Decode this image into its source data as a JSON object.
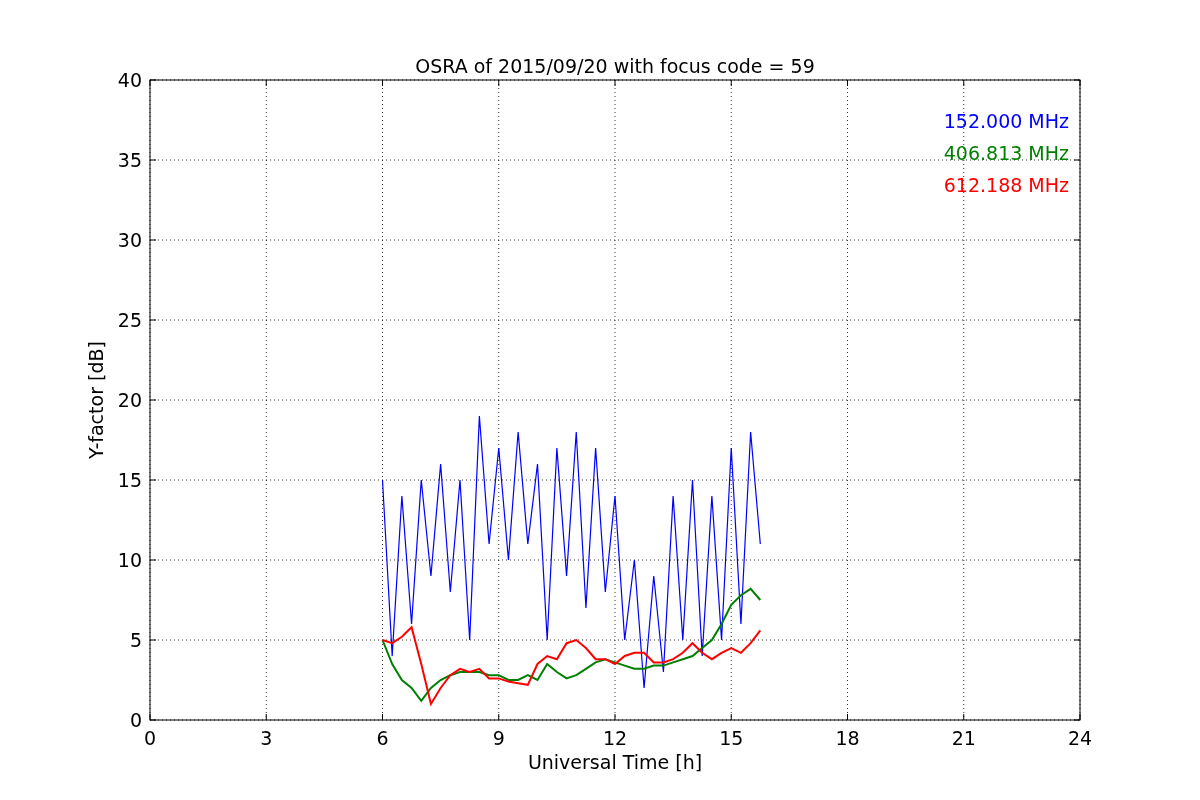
{
  "chart_data": {
    "type": "line",
    "title": "OSRA of 2015/09/20 with focus code = 59",
    "xlabel": "Universal Time [h]",
    "ylabel": "Y-factor [dB]",
    "x": [
      6,
      6.25,
      6.5,
      6.75,
      7,
      7.25,
      7.5,
      7.75,
      8,
      8.25,
      8.5,
      8.75,
      9,
      9.25,
      9.5,
      9.75,
      10,
      10.25,
      10.5,
      10.75,
      11,
      11.25,
      11.5,
      11.75,
      12,
      12.25,
      12.5,
      12.75,
      13,
      13.25,
      13.5,
      13.75,
      14,
      14.25,
      14.5,
      14.75,
      15,
      15.25,
      15.5,
      15.75
    ],
    "series": [
      {
        "name": "152.000 MHz",
        "color": "#0000ff",
        "values": [
          15,
          4,
          14,
          6,
          15,
          9,
          16,
          8,
          15,
          5,
          19,
          11,
          17,
          10,
          18,
          11,
          16,
          5,
          17,
          9,
          18,
          7,
          17,
          8,
          14,
          5,
          10,
          2,
          9,
          3,
          14,
          5,
          15,
          4,
          14,
          5,
          17,
          6,
          18,
          11
        ]
      },
      {
        "name": "406.813 MHz",
        "color": "#008000",
        "values": [
          5,
          3.5,
          2.5,
          2,
          1.2,
          2,
          2.5,
          2.8,
          3,
          3,
          3,
          2.8,
          2.8,
          2.5,
          2.5,
          2.8,
          2.5,
          3.5,
          3,
          2.6,
          2.8,
          3.2,
          3.6,
          3.8,
          3.6,
          3.4,
          3.2,
          3.2,
          3.4,
          3.4,
          3.6,
          3.8,
          4,
          4.5,
          5,
          6,
          7.2,
          7.8,
          8.2,
          7.5
        ]
      },
      {
        "name": "612.188 MHz",
        "color": "#ff0000",
        "values": [
          5,
          4.8,
          5.2,
          5.8,
          3.5,
          1,
          2,
          2.8,
          3.2,
          3,
          3.2,
          2.6,
          2.6,
          2.4,
          2.3,
          2.2,
          3.5,
          4,
          3.8,
          4.8,
          5,
          4.5,
          3.8,
          3.8,
          3.5,
          4,
          4.2,
          4.2,
          3.6,
          3.6,
          3.8,
          4.2,
          4.8,
          4.2,
          3.8,
          4.2,
          4.5,
          4.2,
          4.8,
          5.6
        ]
      }
    ],
    "xlim": [
      0,
      24
    ],
    "ylim": [
      0,
      40
    ],
    "xticks": [
      0,
      3,
      6,
      9,
      12,
      15,
      18,
      21,
      24
    ],
    "yticks": [
      0,
      5,
      10,
      15,
      20,
      25,
      30,
      35,
      40
    ],
    "grid": true
  }
}
